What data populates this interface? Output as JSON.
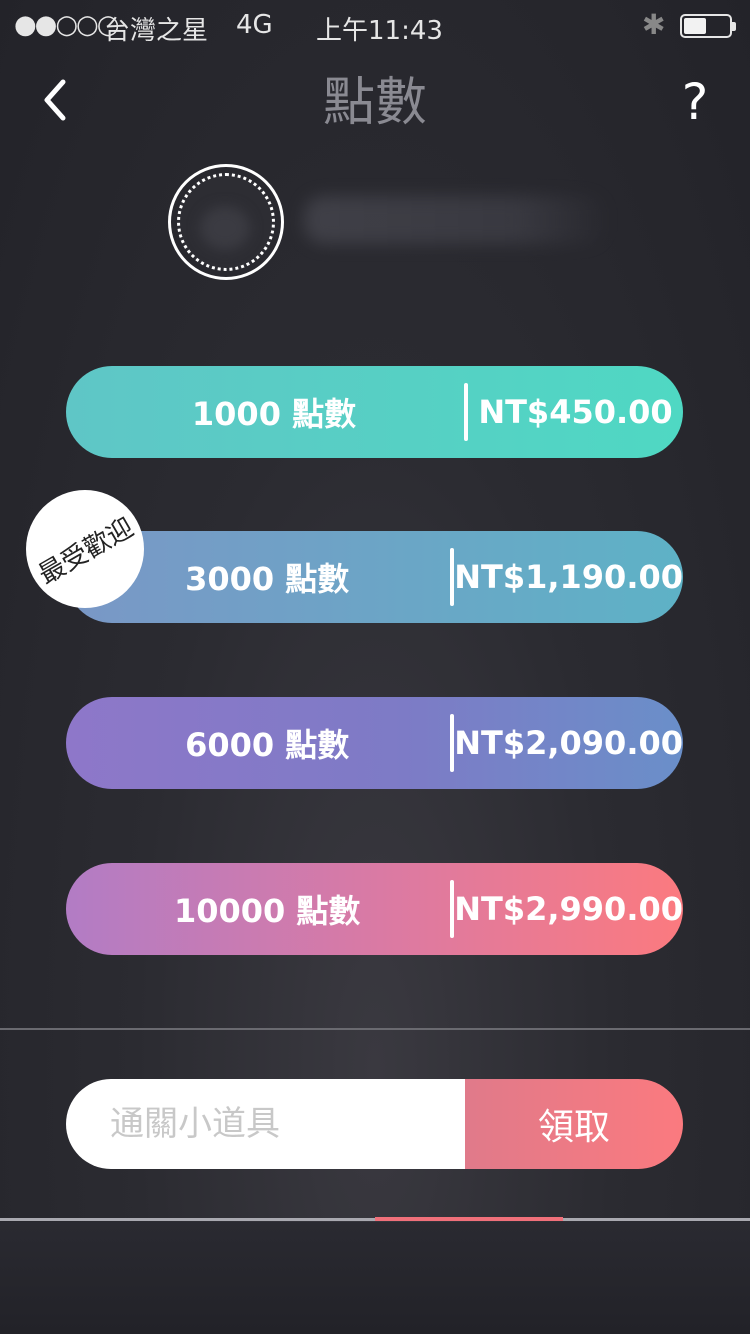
{
  "status_bar": {
    "signal": "●●○○○",
    "carrier": "台灣之星",
    "network": "4G",
    "time": "上午11:43",
    "bluetooth_icon": "bluetooth-icon",
    "battery_level": 0.45
  },
  "nav": {
    "title": "點數",
    "back_icon": "chevron-left-icon",
    "help_label": "?"
  },
  "profile": {
    "avatar_icon": "avatar-placeholder"
  },
  "packages": [
    {
      "points": "1000 點數",
      "price": "NT$450.00"
    },
    {
      "points": "3000 點數",
      "price": "NT$1,190.00"
    },
    {
      "points": "6000 點數",
      "price": "NT$2,090.00"
    },
    {
      "points": "10000 點數",
      "price": "NT$2,990.00"
    }
  ],
  "badge": {
    "label": "最受歡迎"
  },
  "redeem": {
    "placeholder": "通關小道具",
    "button_label": "領取"
  },
  "colors": {
    "background": "#2b2b31",
    "accent": "#fb7a7f",
    "teal": "#4fd8c3",
    "purple": "#8e77c9"
  }
}
